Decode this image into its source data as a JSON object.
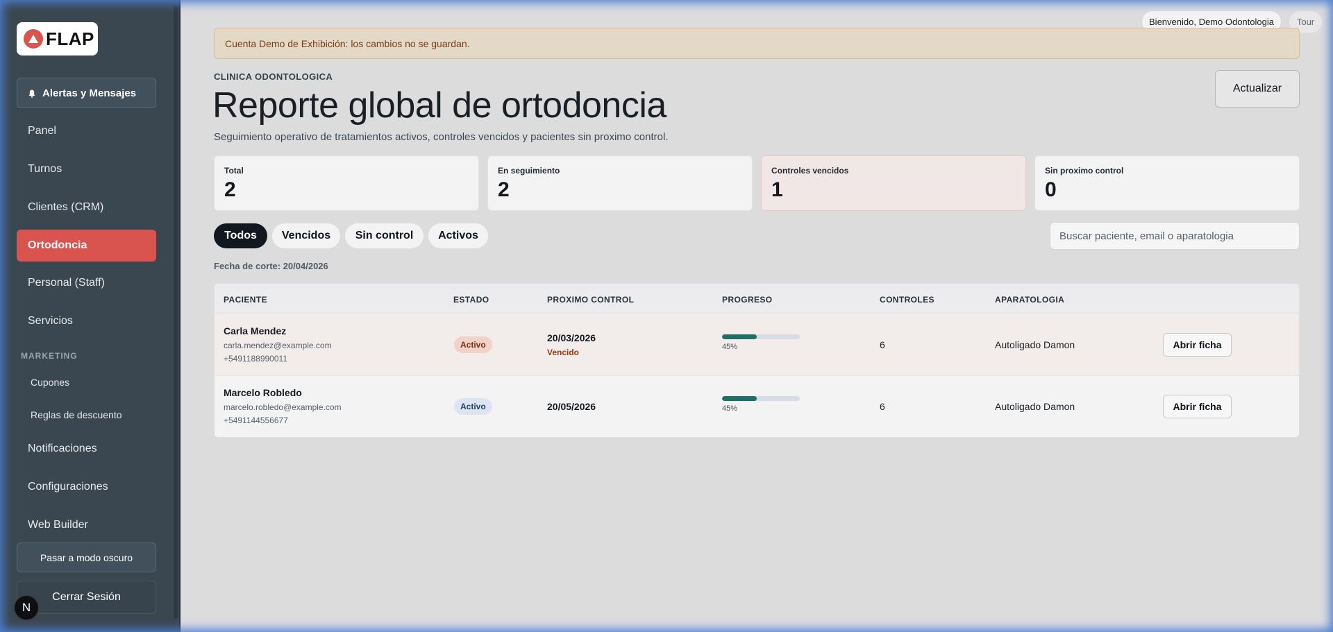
{
  "sidebar": {
    "logo_text": "FLAP",
    "alerts_label": "Alertas y Mensajes",
    "items": [
      {
        "label": "Panel"
      },
      {
        "label": "Turnos"
      },
      {
        "label": "Clientes (CRM)"
      },
      {
        "label": "Ortodoncia"
      },
      {
        "label": "Personal (Staff)"
      },
      {
        "label": "Servicios"
      }
    ],
    "marketing_section": "MARKETING",
    "marketing_items": [
      {
        "label": "Cupones"
      },
      {
        "label": "Reglas de descuento"
      }
    ],
    "items_bottom": [
      {
        "label": "Notificaciones"
      },
      {
        "label": "Configuraciones"
      },
      {
        "label": "Web Builder"
      }
    ],
    "dark_mode_label": "Pasar a modo oscuro",
    "logout_label": "Cerrar Sesión",
    "avatar_letter": "N",
    "accent_color": "#d9534f"
  },
  "topbar": {
    "welcome": "Bienvenido, Demo Odontologia",
    "tour": "Tour"
  },
  "banner": {
    "text": "Cuenta Demo de Exhibición: los cambios no se guardan."
  },
  "header": {
    "eyebrow": "CLINICA ODONTOLOGICA",
    "title": "Reporte global de ortodoncia",
    "subtitle": "Seguimiento operativo de tratamientos activos, controles vencidos y pacientes sin proximo control.",
    "refresh_label": "Actualizar"
  },
  "stats": [
    {
      "label": "Total",
      "value": "2"
    },
    {
      "label": "En seguimiento",
      "value": "2"
    },
    {
      "label": "Controles vencidos",
      "value": "1"
    },
    {
      "label": "Sin proximo control",
      "value": "0"
    }
  ],
  "filters": {
    "chips": [
      {
        "label": "Todos"
      },
      {
        "label": "Vencidos"
      },
      {
        "label": "Sin control"
      },
      {
        "label": "Activos"
      }
    ],
    "search_placeholder": "Buscar paciente, email o aparatologia"
  },
  "cut_date": "Fecha de corte: 20/04/2026",
  "table": {
    "headers": [
      "PACIENTE",
      "ESTADO",
      "PROXIMO CONTROL",
      "PROGRESO",
      "CONTROLES",
      "APARATOLOGIA"
    ],
    "rows": [
      {
        "name": "Carla Mendez",
        "email": "carla.mendez@example.com",
        "phone": "+5491188990011",
        "status": "Activo",
        "next_control": "20/03/2026",
        "control_flag": "Vencido",
        "progress": 45,
        "progress_label": "45%",
        "controls": "6",
        "appliance": "Autoligado Damon",
        "action": "Abrir ficha"
      },
      {
        "name": "Marcelo Robledo",
        "email": "marcelo.robledo@example.com",
        "phone": "+5491144556677",
        "status": "Activo",
        "next_control": "20/05/2026",
        "control_flag": "",
        "progress": 45,
        "progress_label": "45%",
        "controls": "6",
        "appliance": "Autoligado Damon",
        "action": "Abrir ficha"
      }
    ]
  },
  "colors": {
    "progress_fill": "#1f6f66",
    "overdue_text": "#9a3a10",
    "active_chip": "#121820"
  }
}
